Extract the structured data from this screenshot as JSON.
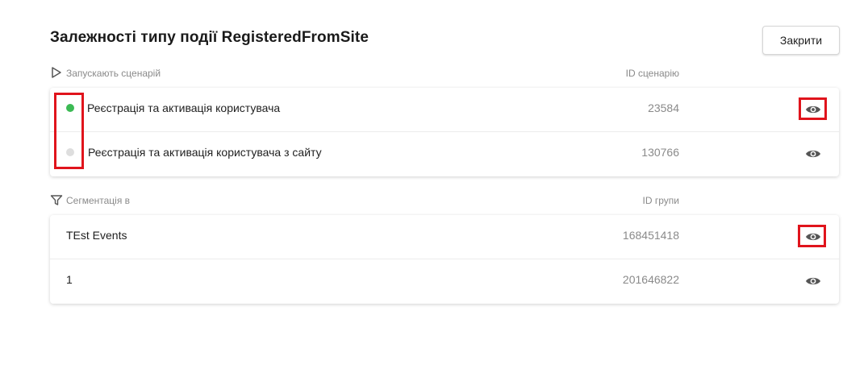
{
  "header": {
    "title": "Залежності типу події RegisteredFromSite",
    "close_label": "Закрити"
  },
  "scenarios": {
    "label": "Запускають сценарій",
    "id_column": "ID сценарію",
    "items": [
      {
        "name": "Реєстрація та активація користувача",
        "id": "23584",
        "status": "active",
        "status_color": "#3cba54"
      },
      {
        "name": "Реєстрація та активація користувача з сайту",
        "id": "130766",
        "status": "inactive",
        "status_color": "#dedede"
      }
    ]
  },
  "segmentation": {
    "label": "Сегментація в",
    "id_column": "ID групи",
    "items": [
      {
        "name": "TEst Events",
        "id": "168451418"
      },
      {
        "name": "1",
        "id": "201646822"
      }
    ]
  },
  "colors": {
    "highlight": "#e0141c",
    "icon": "#555555"
  }
}
